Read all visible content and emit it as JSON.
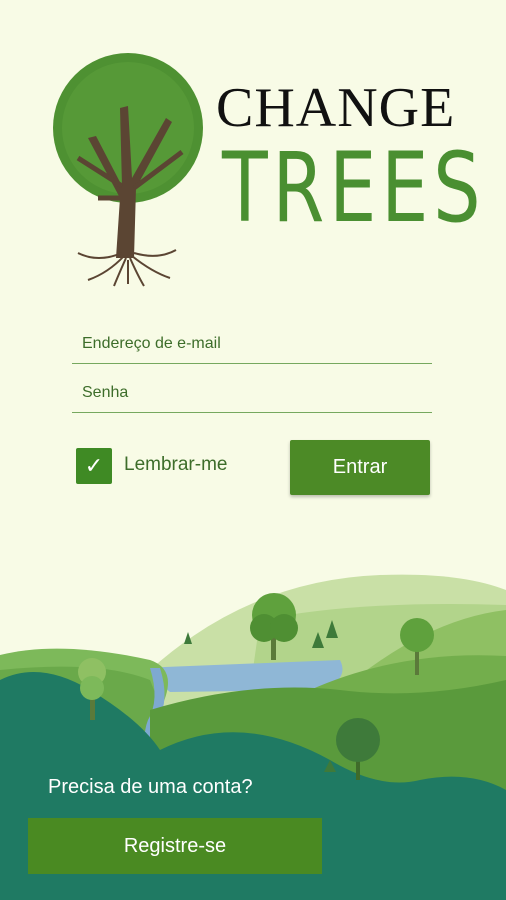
{
  "brand": {
    "line1": "CHANGE",
    "line2": "TREES"
  },
  "login": {
    "email_placeholder": "Endereço de e-mail",
    "password_placeholder": "Senha",
    "remember_label": "Lembrar-me",
    "remember_checked": true,
    "submit_label": "Entrar"
  },
  "signup": {
    "prompt": "Precisa de uma conta?",
    "button_label": "Registre-se"
  },
  "colors": {
    "background": "#f8fbe6",
    "primary_green": "#4c8a26",
    "teal_ground": "#1e7a62"
  }
}
